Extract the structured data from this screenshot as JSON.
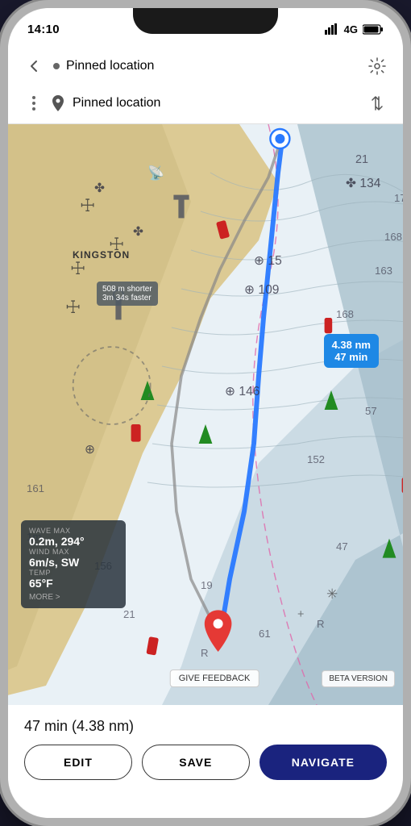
{
  "status_bar": {
    "time": "14:10",
    "network": "4G"
  },
  "nav": {
    "title_row1": "Pinned location",
    "title_row2": "Pinned location",
    "back_label": "back",
    "gear_label": "settings",
    "sort_label": "sort"
  },
  "map": {
    "kingston_label": "KINGSTON",
    "alt_route_line1": "508 m shorter",
    "alt_route_line2": "3m 34s faster",
    "distance_badge_line1": "4.38 nm",
    "distance_badge_line2": "47 min"
  },
  "weather": {
    "wave_label": "WAVE MAX",
    "wave_value": "0.2m, 294°",
    "wind_label": "WIND MAX",
    "wind_value": "6m/s, SW",
    "temp_label": "TEMP",
    "temp_value": "65°F",
    "more_text": "MORE >"
  },
  "feedback": {
    "button_text": "GIVE FEEDBACK",
    "beta_text": "BETA VERSION"
  },
  "bottom_panel": {
    "route_info": "47 min (4.38 nm)",
    "edit_btn": "EDIT",
    "save_btn": "SAVE",
    "navigate_btn": "NAVIGATE"
  }
}
